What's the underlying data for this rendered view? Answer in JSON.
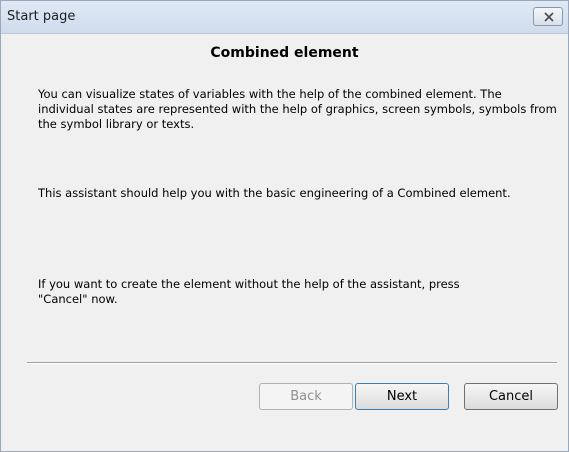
{
  "window": {
    "title": "Start page"
  },
  "page": {
    "heading": "Combined element",
    "paragraphs": [
      "You can visualize states of variables with the help of the combined element. The individual states are represented with the help of graphics, screen symbols, symbols from the symbol library or texts.",
      "This assistant should help you with the basic engineering of a Combined element.",
      "If you want to create the element without the help of the assistant, press \"Cancel\" now."
    ]
  },
  "buttons": {
    "back_label": "Back",
    "next_label": "Next",
    "cancel_label": "Cancel"
  },
  "colors": {
    "titlebar": "#cfdcec",
    "background": "#f0f0f0",
    "default_button_border": "#3c7fb1",
    "disabled_text": "#8f8f8f"
  },
  "icons": {
    "close": "close-icon"
  }
}
